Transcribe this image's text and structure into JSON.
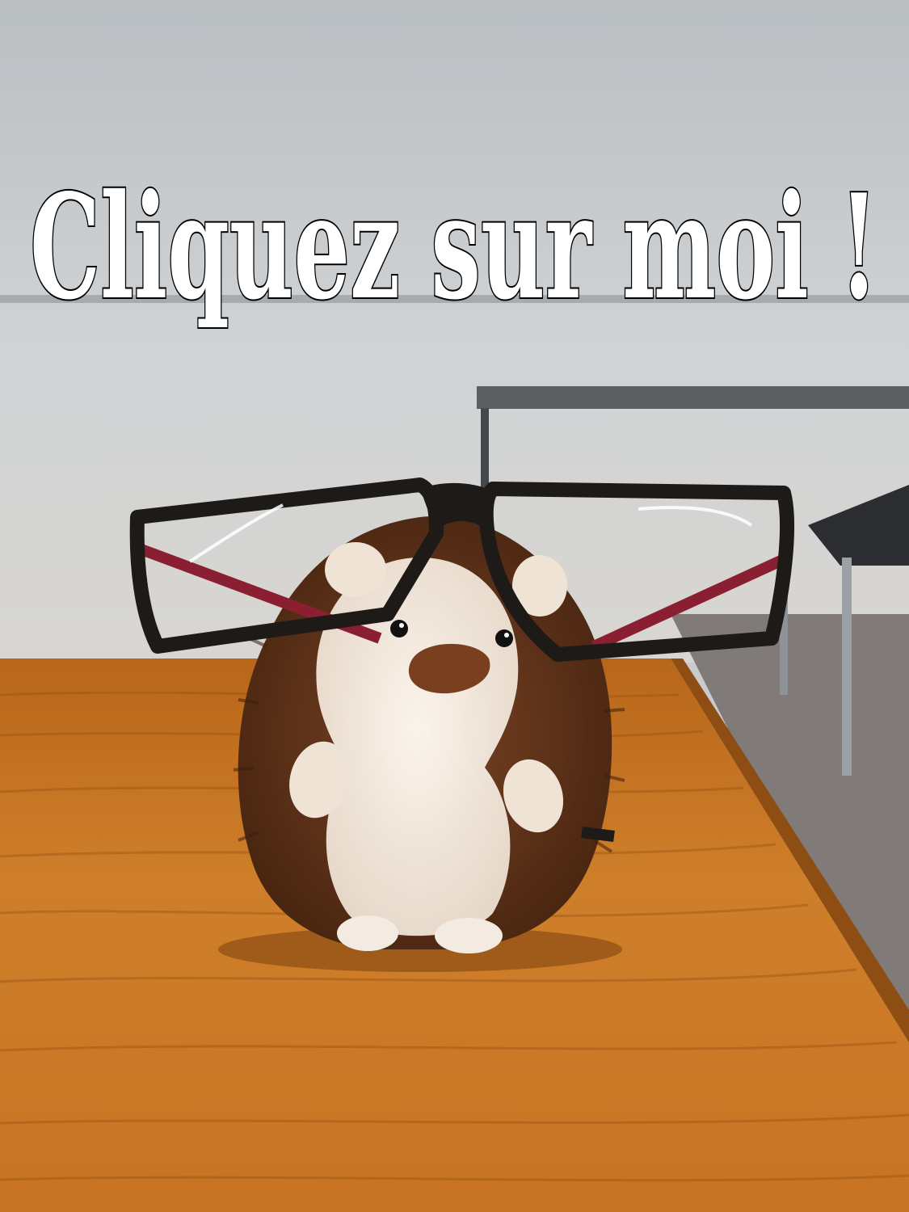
{
  "caption": {
    "text": "Cliquez sur moi !",
    "fill_color": "#ffffff",
    "stroke_color": "#000000"
  },
  "colors": {
    "wall": "#c6cacd",
    "table_top": "#c8741f",
    "table_dark": "#8e4d12",
    "fur_brown": "#6b3a1c",
    "plush_cream": "#f0e6dc",
    "nose": "#7a3f1e",
    "glasses_frame": "#1d1a18",
    "glasses_temple": "#8a1f32"
  }
}
